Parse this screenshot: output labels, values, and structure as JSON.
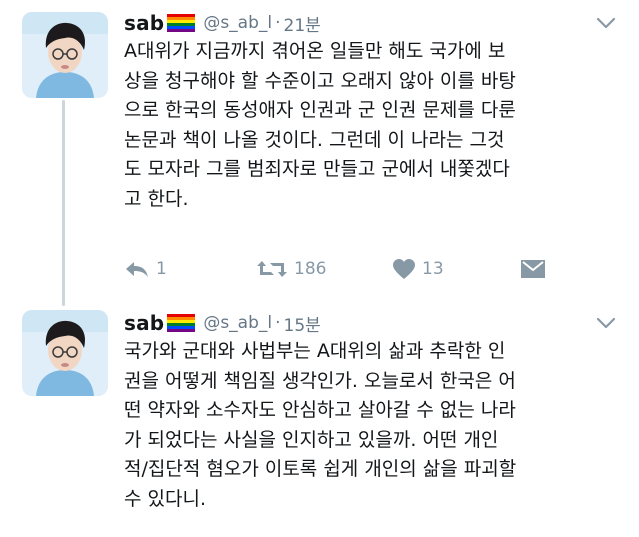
{
  "tweets": [
    {
      "name": "sab",
      "handle": "@s_ab_l",
      "time": "21분",
      "lines": [
        "A대위가 지금까지 겪어온 일들만 해도 국가에 보",
        "상을 청구해야 할 수준이고 오래지 않아 이를 바탕",
        "으로 한국의 동성애자 인권과 군 인권 문제를 다룬",
        "논문과 책이 나올 것이다. 그런데 이 나라는 그것",
        "도 모자라 그를 범죄자로 만들고 군에서 내쫓겠다",
        "고 한다."
      ],
      "reply_count": "1",
      "retweet_count": "186",
      "like_count": "13"
    },
    {
      "name": "sab",
      "handle": "@s_ab_l",
      "time": "15분",
      "lines": [
        "국가와 군대와 사법부는 A대위의 삶과 추락한 인",
        "권을 어떻게 책임질 생각인가. 오늘로서 한국은 어",
        "떤 약자와 소수자도 안심하고 살아갈 수 없는 나라",
        "가 되었다는 사실을 인지하고 있을까. 어떤 개인",
        "적/집단적 혐오가 이토록 쉽게 개인의 삶을 파괴할",
        "수 있다니."
      ]
    }
  ],
  "icons": {
    "badge": "rainbow-flag-icon",
    "menu": "chevron-down-icon",
    "reply": "reply-icon",
    "retweet": "retweet-icon",
    "like": "heart-icon",
    "dm": "envelope-icon"
  },
  "colors": {
    "text": "#14171a",
    "muted": "#657786",
    "icon": "#8899a6",
    "thread_line": "#ccd6dd"
  },
  "separator": "·"
}
